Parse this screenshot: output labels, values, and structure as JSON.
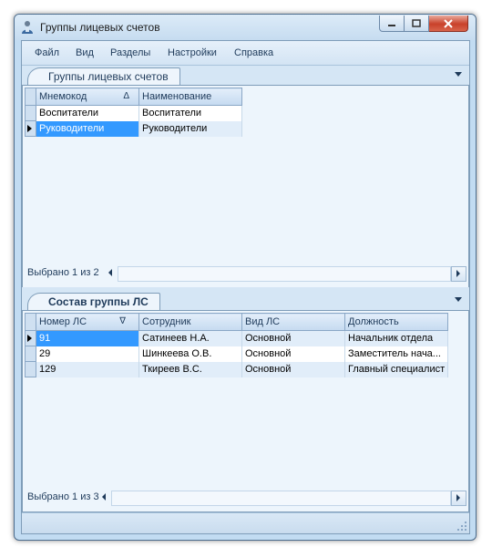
{
  "window": {
    "title": "Группы лицевых счетов"
  },
  "menu": [
    "Файл",
    "Вид",
    "Разделы",
    "Настройки",
    "Справка"
  ],
  "top_panel": {
    "tab_label": "Группы лицевых счетов",
    "columns": [
      "Мнемокод",
      "Наименование"
    ],
    "sort_indicator": "Δ",
    "rows": [
      {
        "code": "Воспитатели",
        "name": "Воспитатели",
        "selected": false
      },
      {
        "code": "Руководители",
        "name": "Руководители",
        "selected": true
      }
    ],
    "status": "Выбрано 1 из 2"
  },
  "bottom_panel": {
    "tab_label": "Состав группы ЛС",
    "columns": [
      "Номер ЛС",
      "Сотрудник",
      "Вид ЛС",
      "Должность"
    ],
    "sort_indicator": "∇",
    "rows": [
      {
        "num": "91",
        "employee": "Сатинеев Н.А.",
        "kind": "Основной",
        "position": "Начальник отдела",
        "selected": true
      },
      {
        "num": "29",
        "employee": "Шинкеева О.В.",
        "kind": "Основной",
        "position": "Заместитель нача...",
        "selected": false
      },
      {
        "num": "129",
        "employee": "Ткиреев В.С.",
        "kind": "Основной",
        "position": "Главный специалист",
        "selected": false
      }
    ],
    "status": "Выбрано 1 из 3"
  },
  "colors": {
    "accent": "#3399ff",
    "frame": "#c2dcf2",
    "close": "#c9402a"
  }
}
